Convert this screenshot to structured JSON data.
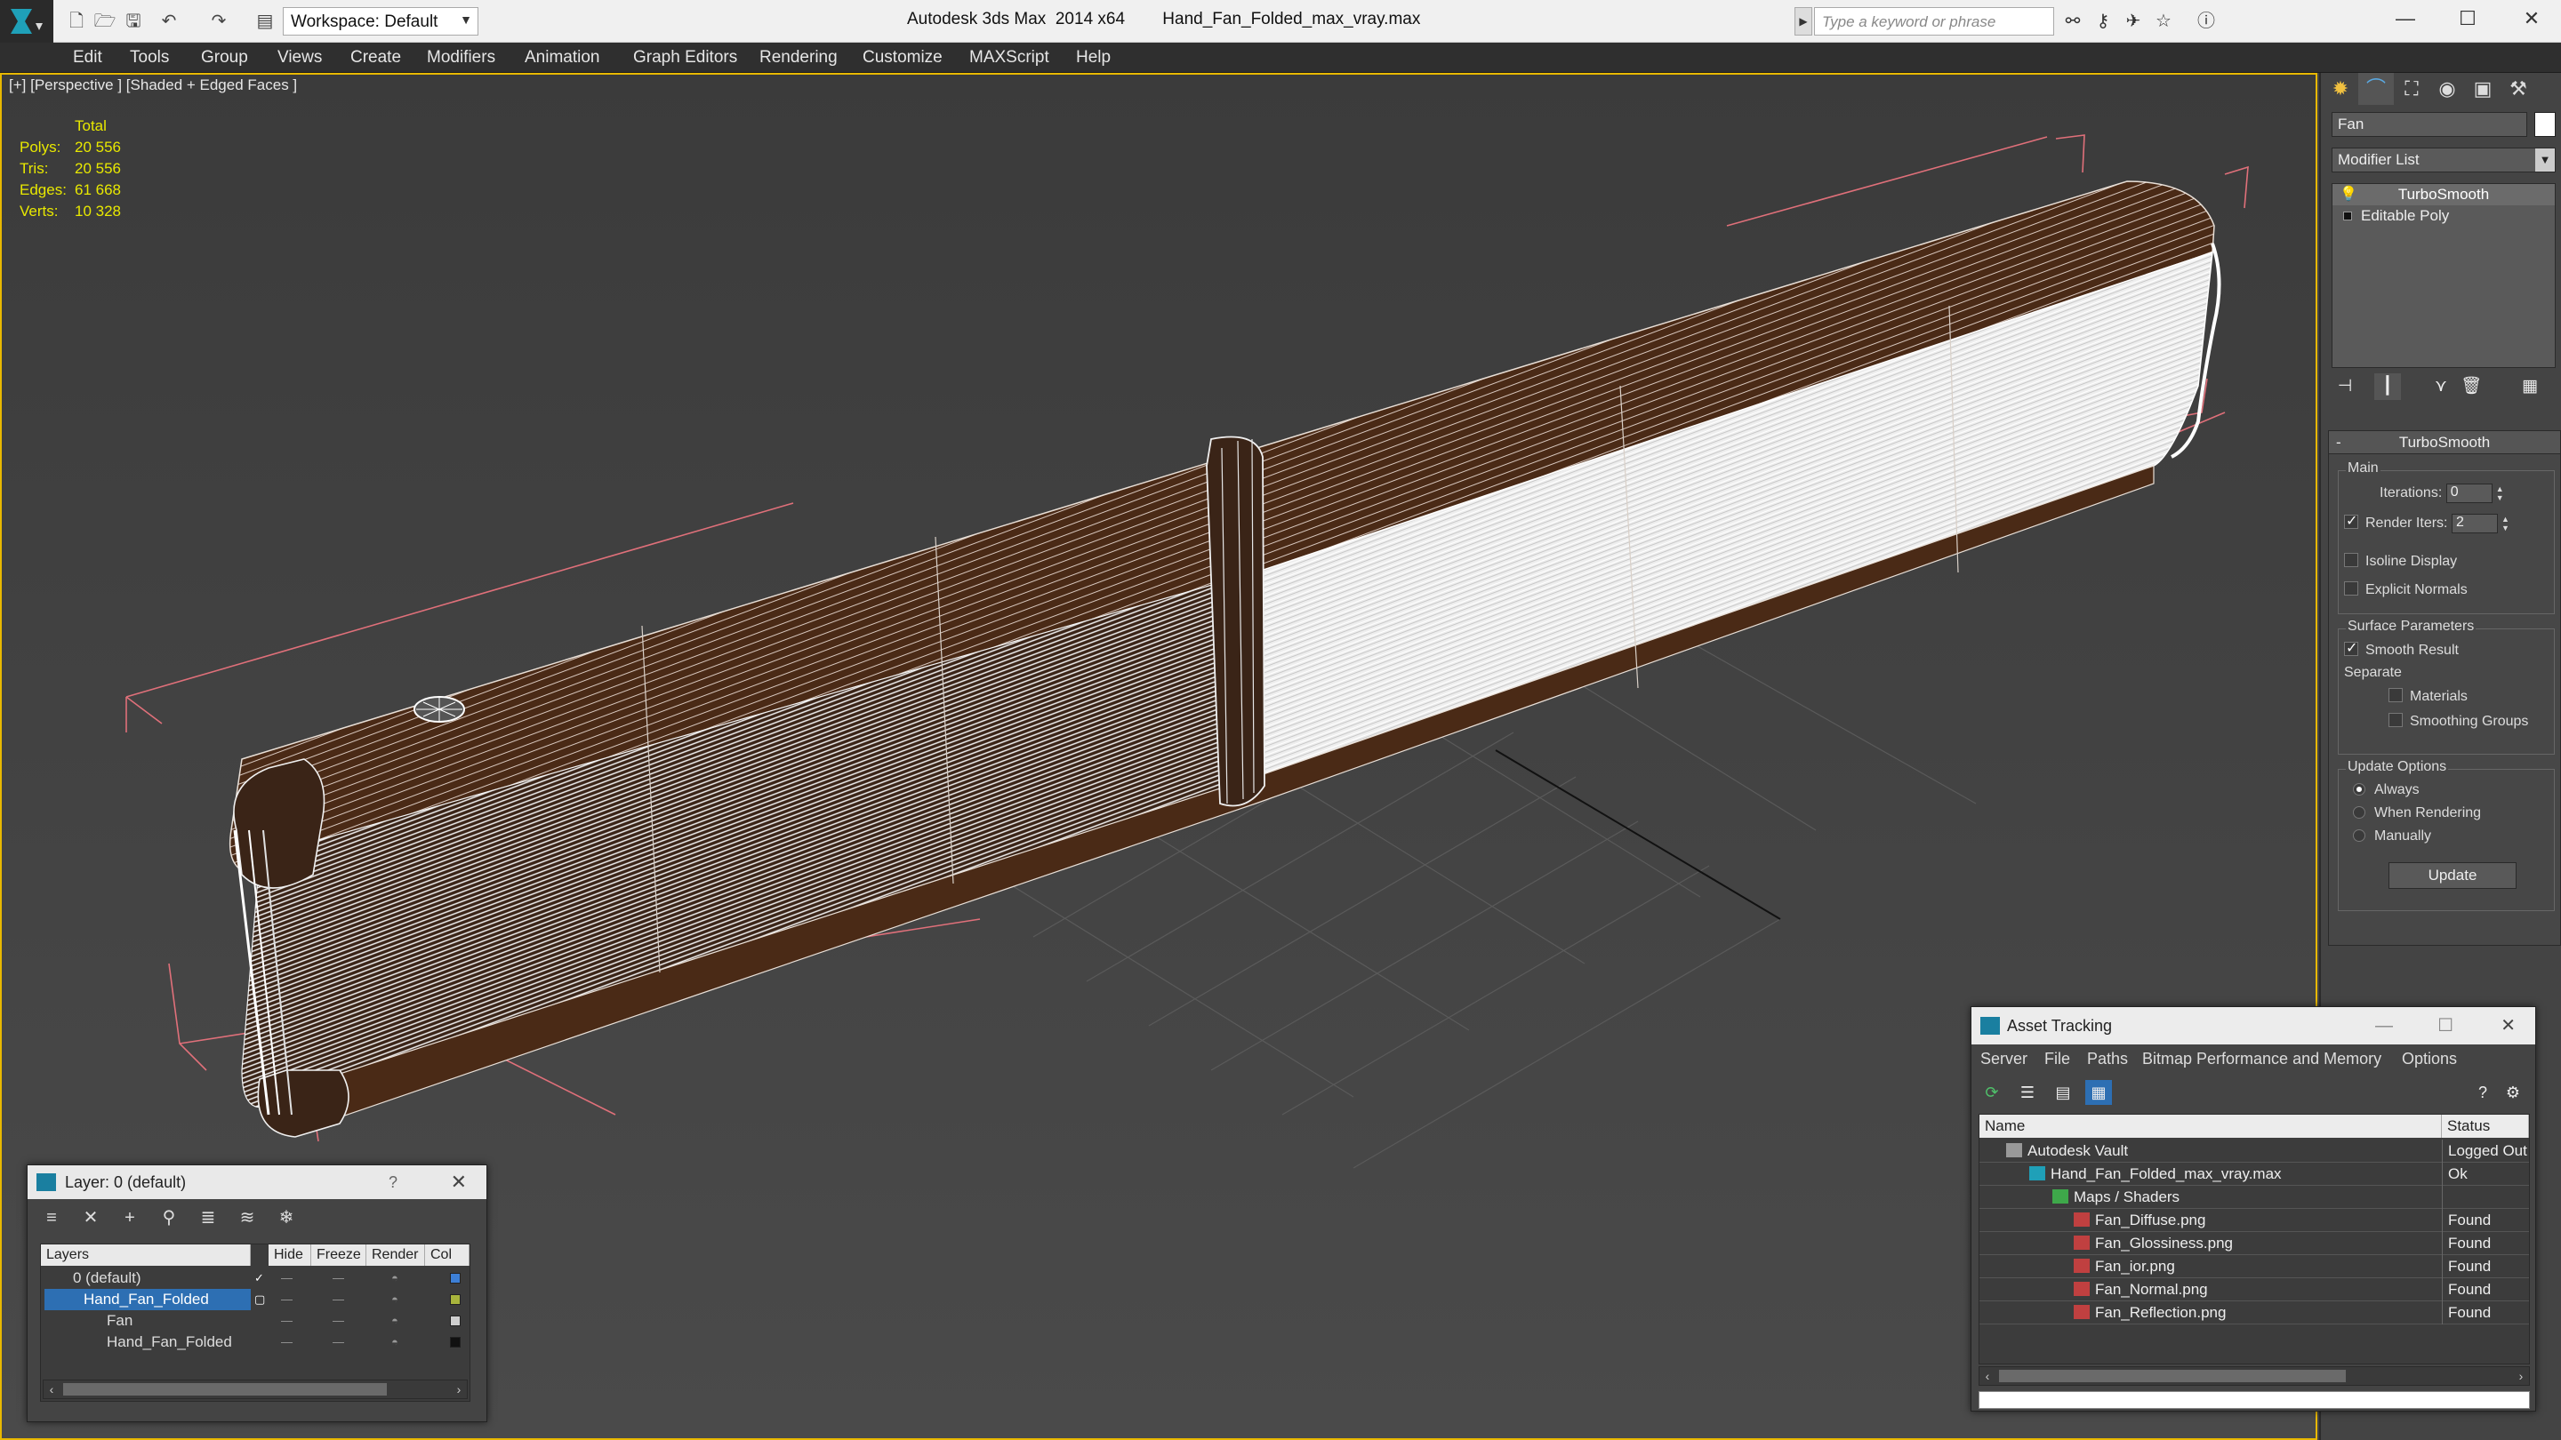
{
  "titlebar": {
    "workspace": "Workspace: Default",
    "app_title": "Autodesk 3ds Max  2014 x64",
    "file_name": "Hand_Fan_Folded_max_vray.max",
    "search_placeholder": "Type a keyword or phrase"
  },
  "menu": {
    "items": [
      "Edit",
      "Tools",
      "Group",
      "Views",
      "Create",
      "Modifiers",
      "Animation",
      "Graph Editors",
      "Rendering",
      "Customize",
      "MAXScript",
      "Help"
    ]
  },
  "viewport": {
    "label": "[+] [Perspective ] [Shaded + Edged Faces ]",
    "stats": {
      "header": "Total",
      "rows": [
        {
          "label": "Polys:",
          "value": "20 556"
        },
        {
          "label": "Tris:",
          "value": "20 556"
        },
        {
          "label": "Edges:",
          "value": "61 668"
        },
        {
          "label": "Verts:",
          "value": "10 328"
        }
      ]
    }
  },
  "command_panel": {
    "object_name": "Fan",
    "modifier_list": "Modifier List",
    "stack": [
      "TurboSmooth",
      "Editable Poly"
    ],
    "rollout_title": "TurboSmooth",
    "main_group": "Main",
    "iterations_label": "Iterations:",
    "iterations_value": "0",
    "render_iters_label": "Render Iters:",
    "render_iters_value": "2",
    "isoline_display": "Isoline Display",
    "explicit_normals": "Explicit Normals",
    "surface_group": "Surface Parameters",
    "smooth_result": "Smooth Result",
    "separate_label": "Separate",
    "materials": "Materials",
    "smoothing_groups": "Smoothing Groups",
    "update_group": "Update Options",
    "always": "Always",
    "when_rendering": "When Rendering",
    "manually": "Manually",
    "update_button": "Update"
  },
  "layer_dialog": {
    "title": "Layer: 0 (default)",
    "help": "?",
    "columns": [
      "Layers",
      "Hide",
      "Freeze",
      "Render",
      "Col"
    ],
    "rows": [
      {
        "name": "0 (default)",
        "color": "#3d7fd6"
      },
      {
        "name": "Hand_Fan_Folded",
        "color": "#a8b43c"
      },
      {
        "name": "Fan",
        "color": "#cfcfcf"
      },
      {
        "name": "Hand_Fan_Folded",
        "color": "#111111"
      }
    ]
  },
  "asset_tracking": {
    "title": "Asset Tracking",
    "menu": [
      "Server",
      "File",
      "Paths",
      "Bitmap Performance and Memory",
      "Options"
    ],
    "columns": [
      "Name",
      "Status"
    ],
    "rows": [
      {
        "name": "Autodesk Vault",
        "status": "Logged Out"
      },
      {
        "name": "Hand_Fan_Folded_max_vray.max",
        "status": "Ok"
      },
      {
        "name": "Maps / Shaders",
        "status": ""
      },
      {
        "name": "Fan_Diffuse.png",
        "status": "Found"
      },
      {
        "name": "Fan_Glossiness.png",
        "status": "Found"
      },
      {
        "name": "Fan_ior.png",
        "status": "Found"
      },
      {
        "name": "Fan_Normal.png",
        "status": "Found"
      },
      {
        "name": "Fan_Reflection.png",
        "status": "Found"
      }
    ]
  },
  "colors": {
    "viewport_border": "#e8b800",
    "stats_text": "#e8e800",
    "wood": "#4a2a16",
    "selection": "#2d6fb3"
  }
}
